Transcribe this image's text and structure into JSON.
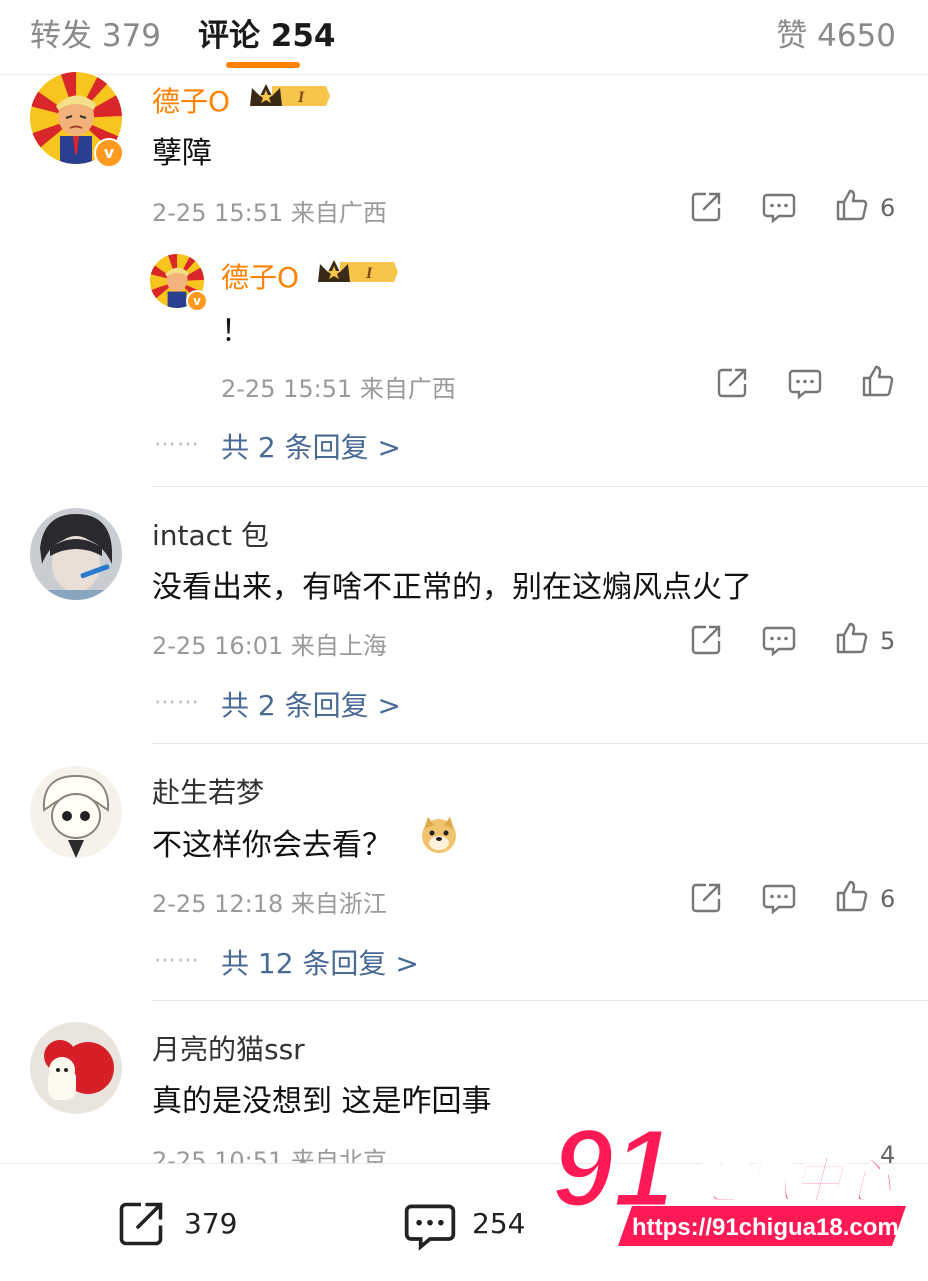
{
  "tabs": {
    "repost": "转发 379",
    "comments": "评论 254",
    "likes": "赞 4650"
  },
  "comments": [
    {
      "user": "德子O",
      "text": "孽障",
      "time": "2-25 15:51",
      "location": "来自广西",
      "likes": "6",
      "reply": {
        "user": "德子O",
        "text": "！",
        "time": "2-25 15:51",
        "location": "来自广西"
      },
      "more_replies": "共 2 条回复 >"
    },
    {
      "user": "intact 包",
      "text": "没看出来，有啥不正常的，别在这煽风点火了",
      "time": "2-25 16:01",
      "location": "来自上海",
      "likes": "5",
      "more_replies": "共 2 条回复 >"
    },
    {
      "user": "赴生若梦",
      "text": "不这样你会去看？",
      "time": "2-25 12:18",
      "location": "来自浙江",
      "likes": "6",
      "more_replies": "共 12 条回复 >"
    },
    {
      "user": "月亮的猫ssr",
      "text": "真的是没想到 这是咋回事",
      "time": "2-25 10:51",
      "location": "来自北京",
      "likes": "4"
    }
  ],
  "crown_level": "I",
  "verified_mark": "v",
  "dots": "⋯⋯",
  "bottom_bar": {
    "repost_count": "379",
    "comment_count": "254"
  },
  "watermark": {
    "number": "91",
    "brand": "吃瓜中心",
    "url": "https://91chigua18.com"
  },
  "colors": {
    "accent": "#ff8200",
    "link": "#4a6a96",
    "watermark": "#ff1a55"
  }
}
